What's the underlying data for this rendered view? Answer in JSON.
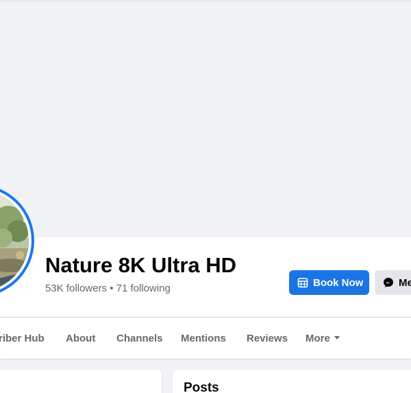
{
  "page": {
    "title": "Nature 8K Ultra HD",
    "stats": "53K followers • 71 following"
  },
  "actions": {
    "primary_label": "Book Now",
    "secondary_label": "Me"
  },
  "tabs": [
    {
      "label": "riber Hub"
    },
    {
      "label": "About"
    },
    {
      "label": "Channels"
    },
    {
      "label": "Mentions"
    },
    {
      "label": "Reviews"
    },
    {
      "label": "More"
    }
  ],
  "content": {
    "posts_title": "Posts"
  },
  "colors": {
    "accent": "#1b74e4",
    "background": "#f0f2f5",
    "text_secondary": "#65676b"
  },
  "icons": {
    "book_button": "calendar-icon",
    "message_button": "messenger-icon",
    "more_tab": "caret-down-icon"
  }
}
